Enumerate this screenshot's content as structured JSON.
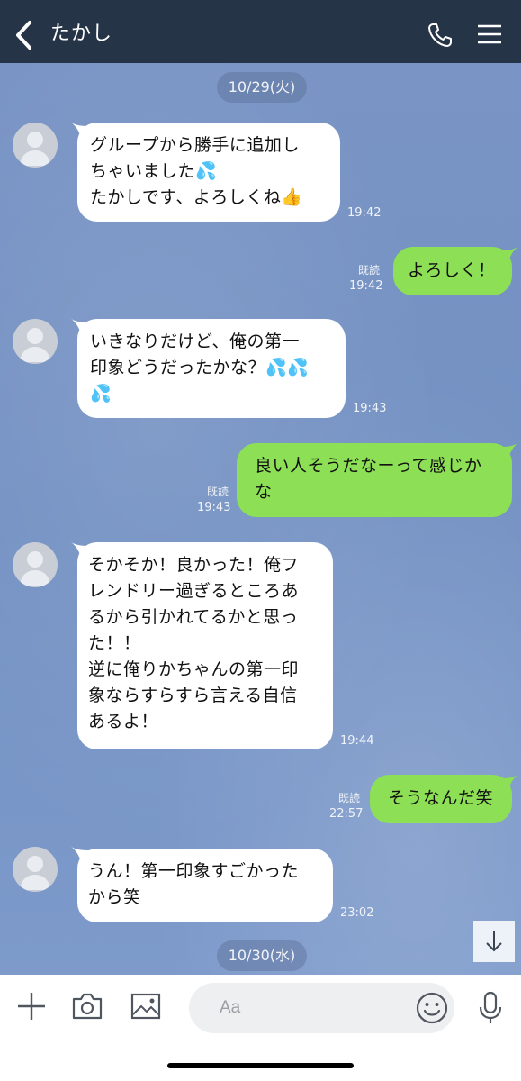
{
  "header": {
    "title": "たかし",
    "back_icon": "chevron-left-icon",
    "call_icon": "phone-icon",
    "menu_icon": "hamburger-menu-icon",
    "background": "#263447"
  },
  "chat": {
    "background": "#7390c1",
    "incoming_bubble_color": "#ffffff",
    "outgoing_bubble_color": "#8de055",
    "dates": [
      "10/29(火)",
      "10/30(水)"
    ],
    "messages": [
      {
        "direction": "in",
        "text": "グループから勝手に追加し\nちゃいました💦\nたかしです、よろしくね👍",
        "time": "19:42"
      },
      {
        "direction": "out",
        "text": "よろしく！",
        "time": "19:42",
        "read": "既読"
      },
      {
        "direction": "in",
        "text": "いきなりだけど、俺の第一\n印象どうだったかな？💦💦\n💦",
        "time": "19:43"
      },
      {
        "direction": "out",
        "text": "良い人そうだなーって感じか\nな",
        "time": "19:43",
        "read": "既読"
      },
      {
        "direction": "in",
        "text": "そかそか！良かった！俺フ\nレンドリー過ぎるところあ\nるから引かれてるかと思っ\nた！！\n逆に俺りかちゃんの第一印\n象ならすらすら言える自信\nあるよ！",
        "time": "19:44"
      },
      {
        "direction": "out",
        "text": "そうなんだ笑",
        "time": "22:57",
        "read": "既読"
      },
      {
        "direction": "in",
        "text": "うん！第一印象すごかった\nから笑",
        "time": "23:02"
      }
    ]
  },
  "scroll_button": {
    "icon": "arrow-down-icon"
  },
  "composer": {
    "placeholder": "Aa",
    "tools": [
      "plus-icon",
      "camera-icon",
      "image-icon"
    ],
    "emoji_icon": "smiley-icon",
    "mic_icon": "microphone-icon"
  }
}
